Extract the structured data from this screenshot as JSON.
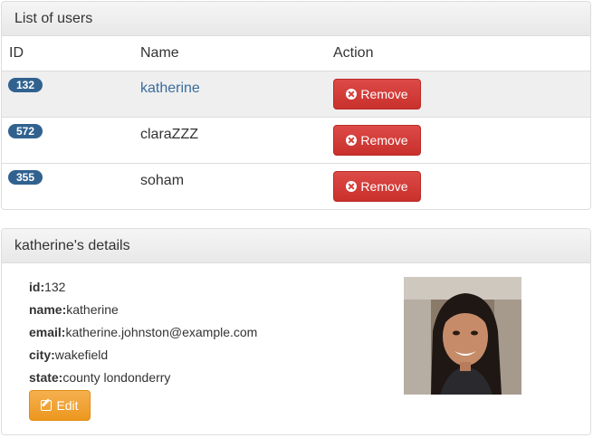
{
  "users_panel": {
    "title": "List of users",
    "columns": {
      "id": "ID",
      "name": "Name",
      "action": "Action"
    },
    "rows": [
      {
        "id": "132",
        "name": "katherine",
        "selected": true,
        "action_label": "Remove"
      },
      {
        "id": "572",
        "name": "claraZZZ",
        "selected": false,
        "action_label": "Remove"
      },
      {
        "id": "355",
        "name": "soham",
        "selected": false,
        "action_label": "Remove"
      }
    ]
  },
  "details_panel": {
    "title": "katherine's details",
    "fields": [
      {
        "label": "id:",
        "value": "132"
      },
      {
        "label": "name:",
        "value": "katherine"
      },
      {
        "label": "email:",
        "value": "katherine.johnston@example.com"
      },
      {
        "label": "city:",
        "value": "wakefield"
      },
      {
        "label": "state:",
        "value": "county londonderry"
      }
    ],
    "edit_label": "Edit"
  },
  "colors": {
    "badge": "#31628f",
    "remove_button": "#d9534f",
    "edit_button": "#f0ad4e",
    "link": "#3a6b9e"
  },
  "icons": {
    "remove": "times-circle-icon",
    "edit": "edit-icon"
  }
}
